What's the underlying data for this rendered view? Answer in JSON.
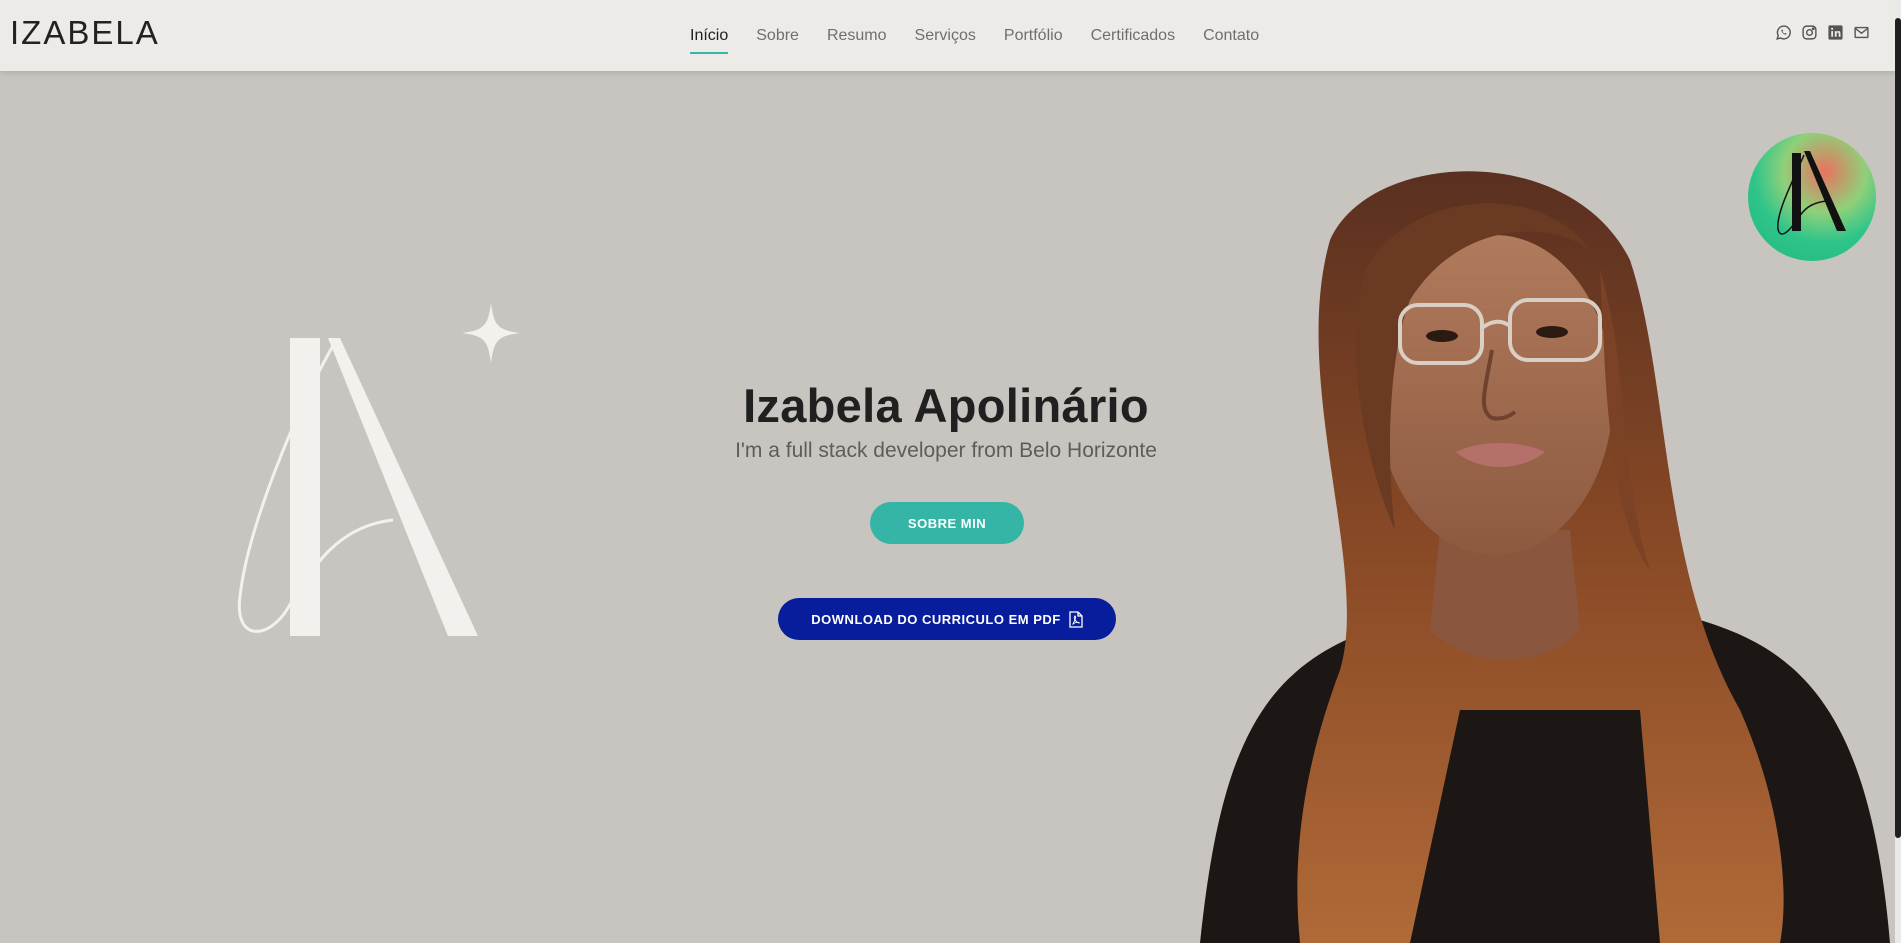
{
  "header": {
    "brand": "IZABELA",
    "nav": [
      {
        "label": "Início",
        "active": true
      },
      {
        "label": "Sobre",
        "active": false
      },
      {
        "label": "Resumo",
        "active": false
      },
      {
        "label": "Serviços",
        "active": false
      },
      {
        "label": "Portfólio",
        "active": false
      },
      {
        "label": "Certificados",
        "active": false
      },
      {
        "label": "Contato",
        "active": false
      }
    ],
    "social_icons": [
      "whatsapp-icon",
      "instagram-icon",
      "linkedin-icon",
      "mail-icon"
    ]
  },
  "hero": {
    "title": "Izabela Apolinário",
    "subtitle": "I'm a full stack developer from Belo Horizonte",
    "about_button": "SOBRE MIN",
    "pdf_button": "DOWNLOAD DO CURRICULO EM PDF"
  },
  "colors": {
    "background": "#c8c5c0",
    "header": "#ecebe8",
    "accent": "#35b5a6",
    "pdf_button": "#071d9c"
  }
}
